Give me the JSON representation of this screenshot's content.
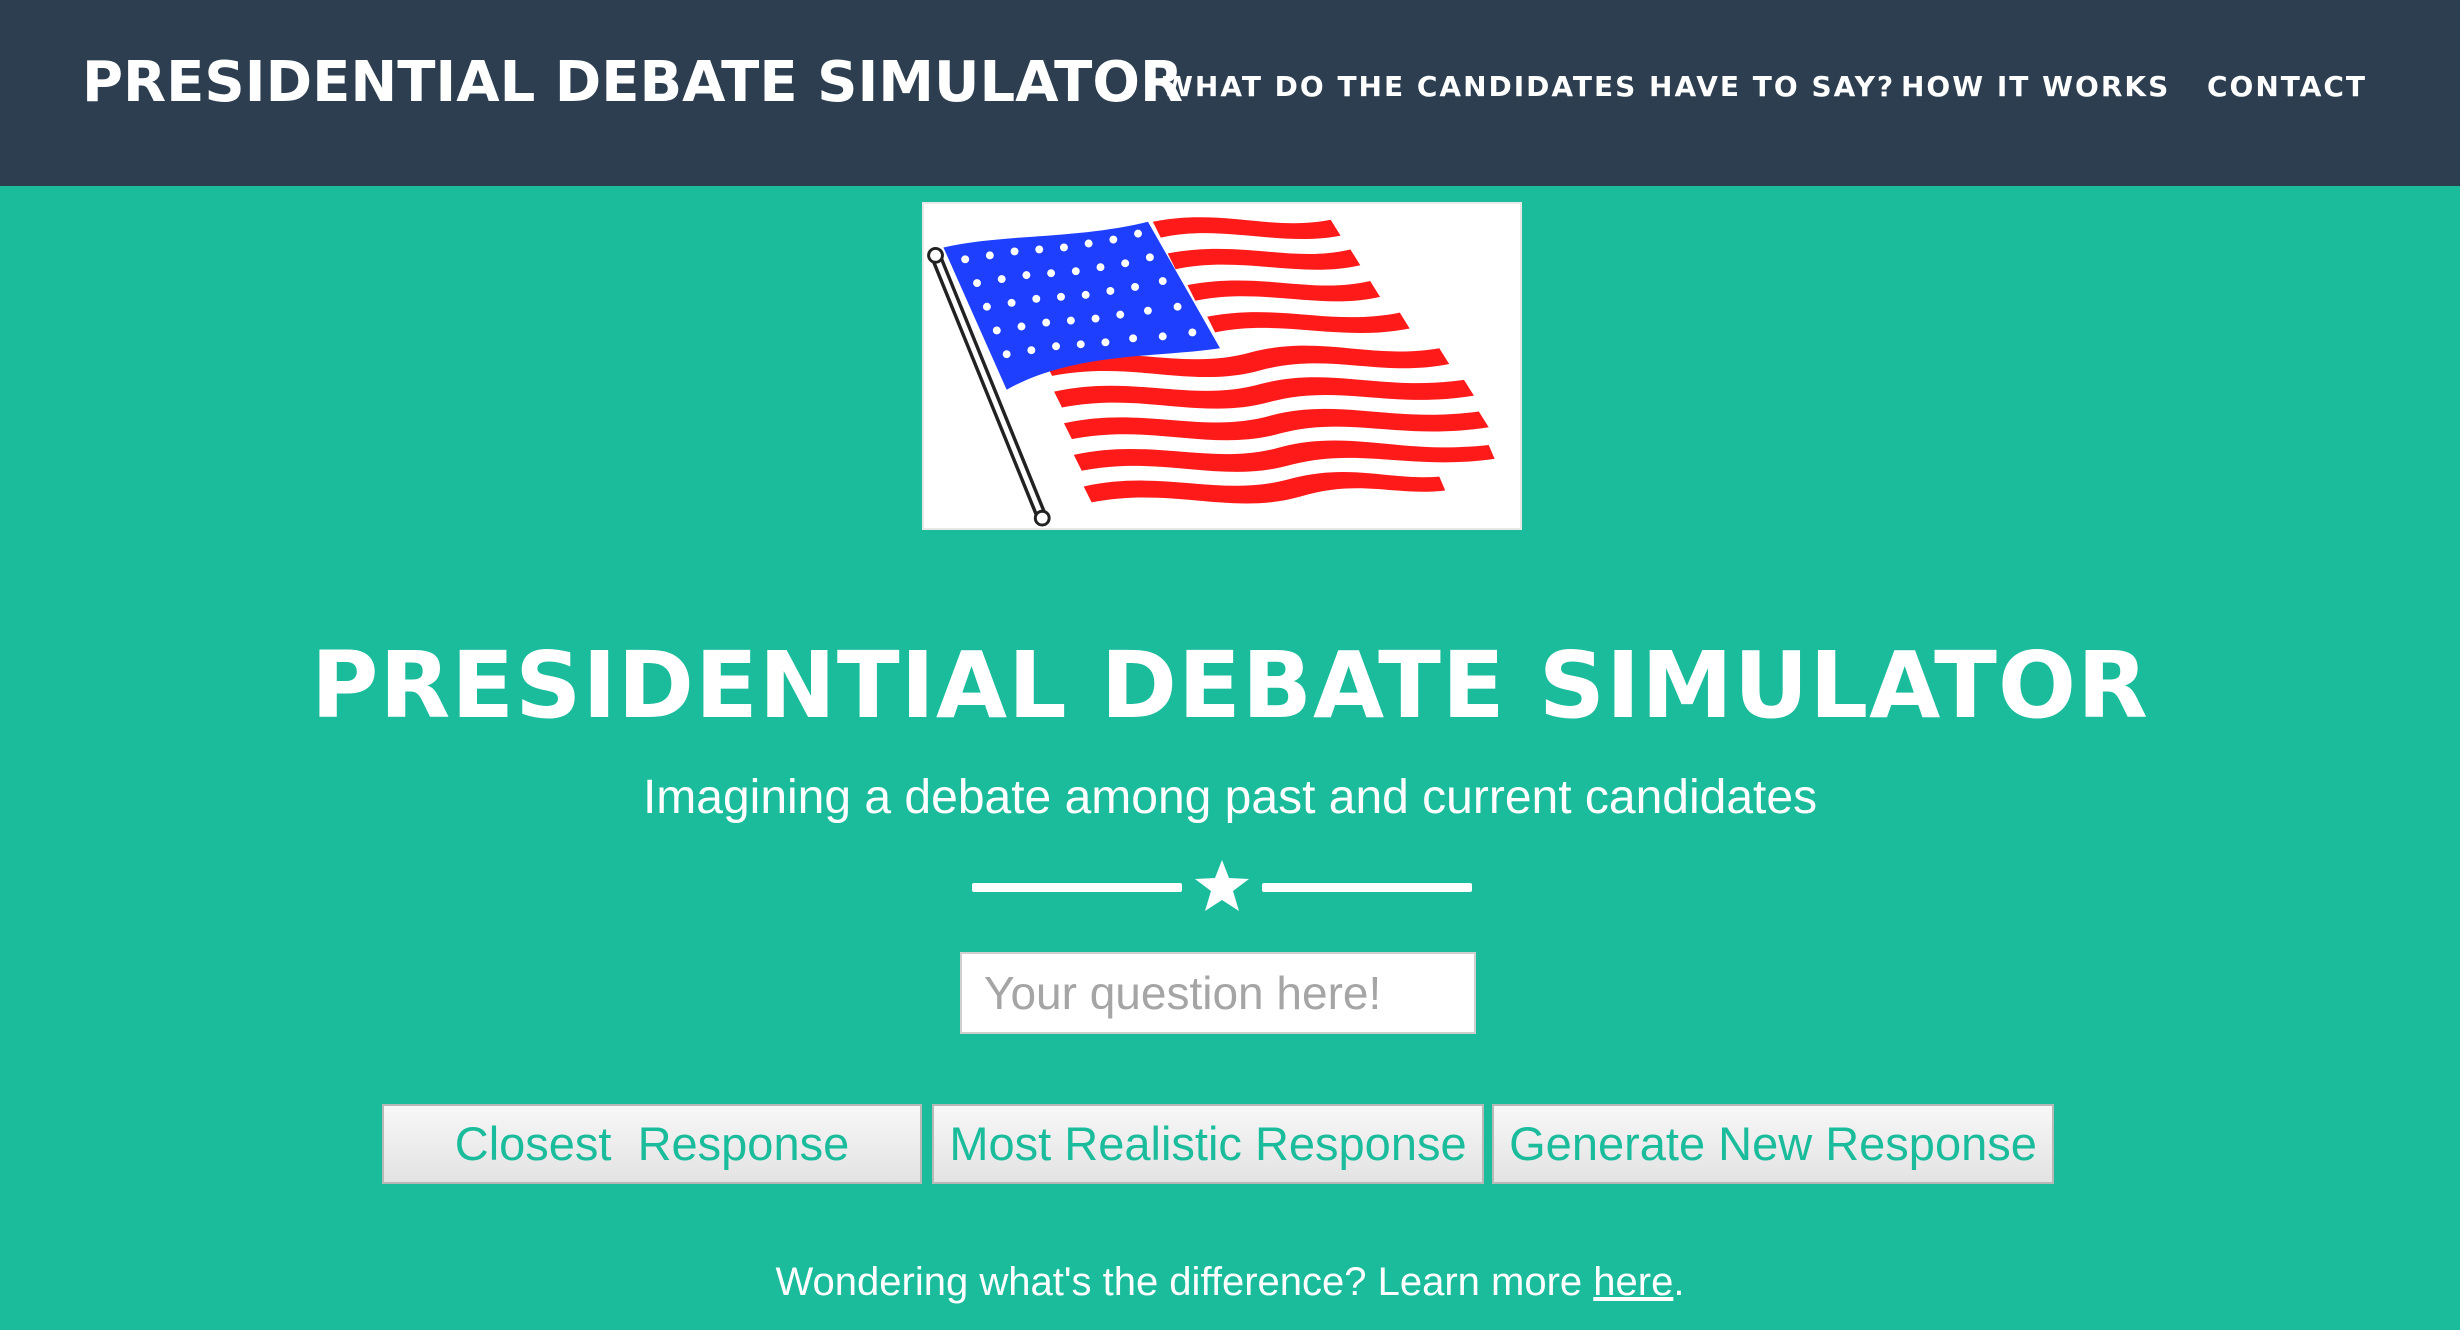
{
  "navbar": {
    "brand": "PRESIDENTIAL DEBATE SIMULATOR",
    "links": [
      {
        "label": "WHAT DO THE CANDIDATES HAVE TO SAY?"
      },
      {
        "label": "HOW IT WORKS"
      },
      {
        "label": "CONTACT"
      }
    ]
  },
  "hero": {
    "image": "american-flag",
    "title": "PRESIDENTIAL DEBATE SIMULATOR",
    "subtitle": "Imagining a debate among past and current candidates",
    "divider_icon": "star-icon"
  },
  "question": {
    "value": "",
    "placeholder": "Your question here!"
  },
  "buttons": {
    "closest": "Closest  Response",
    "realistic": "Most Realistic Response",
    "generate": "Generate New Response"
  },
  "footer": {
    "text": "Wondering what's the difference? Learn more ",
    "link": "here",
    "end": "."
  },
  "colors": {
    "background": "#1abc9c",
    "navbar": "#2c3e50",
    "text": "#ffffff",
    "flag_blue": "#1f3fff",
    "flag_red": "#ff1a1a"
  }
}
